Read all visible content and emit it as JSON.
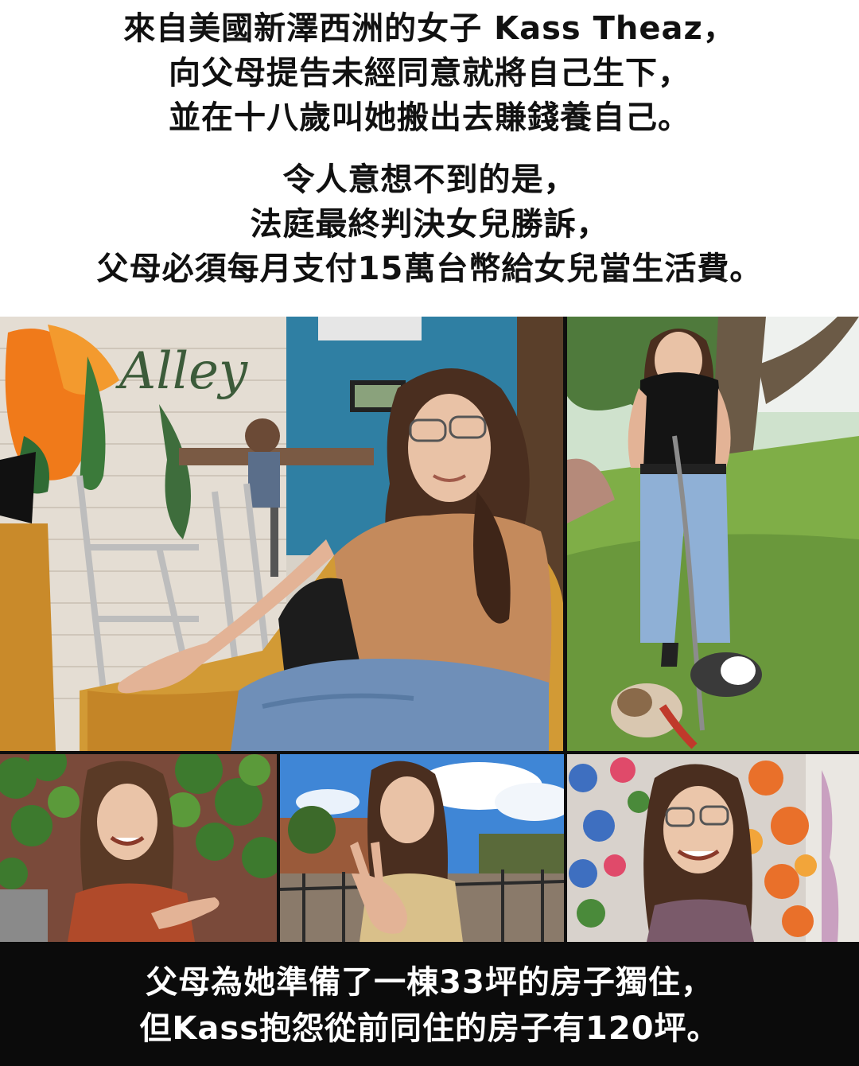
{
  "header": {
    "paragraph_1": [
      "來自美國新澤西洲的女子 Kass Theaz，",
      "向父母提告未經同意就將自己生下，",
      "並在十八歲叫她搬出去賺錢養自己。"
    ],
    "paragraph_2": [
      "令人意想不到的是，",
      "法庭最終判決女兒勝訴，",
      "父母必須每月支付15萬台幣給女兒當生活費。"
    ]
  },
  "photos": {
    "cafe_sign_text": "Alley"
  },
  "footer": {
    "caption": [
      "父母為她準備了一棟33坪的房子獨住，",
      "但Kass抱怨從前同住的房子有120坪。"
    ]
  },
  "colors": {
    "page_background": "#ffffff",
    "caption_background": "#0b0b0b",
    "caption_text": "#ffffff",
    "header_text": "#111111"
  }
}
